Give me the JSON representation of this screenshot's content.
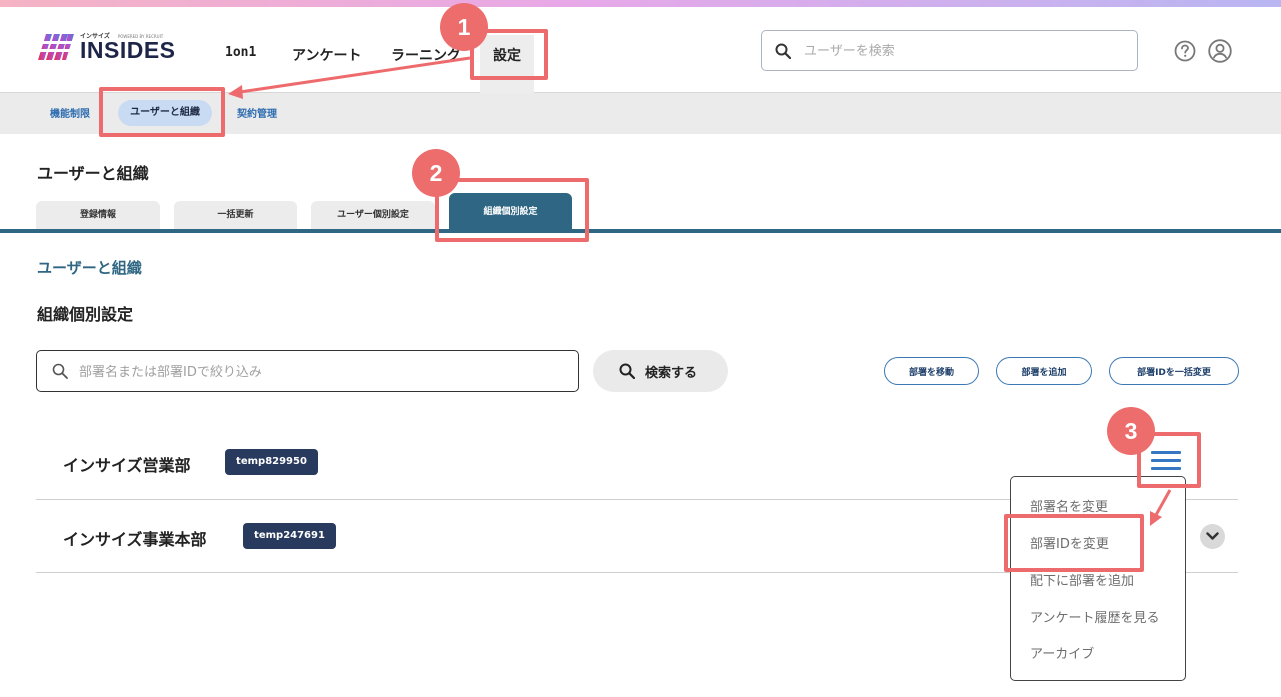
{
  "brand": {
    "small_text": "インサイズ",
    "by_text": "POWERED BY RECRUIT",
    "name": "INSIDES"
  },
  "nav": {
    "items": [
      "1on1",
      "アンケート",
      "ラーニング",
      "設定"
    ]
  },
  "search": {
    "placeholder": "ユーザーを検索"
  },
  "subnav": {
    "items": [
      "機能制限",
      "ユーザーと組織",
      "契約管理"
    ]
  },
  "page": {
    "heading": "ユーザーと組織",
    "breadcrumb": "ユーザーと組織",
    "section_title": "組織個別設定"
  },
  "tabs": [
    "登録情報",
    "一括更新",
    "ユーザー個別設定",
    "組織個別設定"
  ],
  "filter": {
    "placeholder": "部署名または部署IDで絞り込み",
    "button_label": "検索する"
  },
  "actions": [
    "部署を移動",
    "部署を追加",
    "部署IDを一括変更"
  ],
  "departments": [
    {
      "name": "インサイズ営業部",
      "id": "temp829950"
    },
    {
      "name": "インサイズ事業本部",
      "id": "temp247691"
    }
  ],
  "menu": {
    "items": [
      "部署名を変更",
      "部署IDを変更",
      "配下に部署を追加",
      "アンケート履歴を見る",
      "アーカイブ"
    ]
  },
  "annotations": {
    "steps": [
      "1",
      "2",
      "3"
    ],
    "color": "#ee6b6d"
  },
  "colors": {
    "accent": "#2e6683",
    "badge": "#293a5f",
    "link": "#3577c3"
  }
}
